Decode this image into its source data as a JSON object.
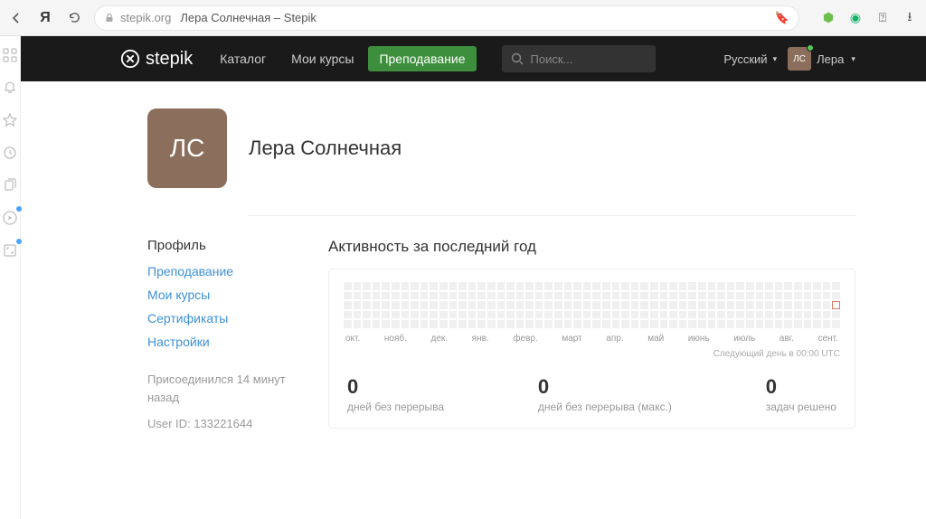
{
  "browser": {
    "domain": "stepik.org",
    "title": "Лера Солнечная – Stepik"
  },
  "topnav": {
    "brand": "stepik",
    "catalog": "Каталог",
    "my_courses": "Мои курсы",
    "teaching": "Преподавание",
    "search_placeholder": "Поиск...",
    "language": "Русский",
    "avatar_initials": "ЛС",
    "user_short": "Лера"
  },
  "profile": {
    "avatar_initials": "ЛС",
    "full_name": "Лера Солнечная"
  },
  "sidebar": {
    "head": "Профиль",
    "links": {
      "teaching": "Преподавание",
      "my_courses": "Мои курсы",
      "certificates": "Сертификаты",
      "settings": "Настройки"
    },
    "joined": "Присоединился 14 минут назад",
    "user_id_label": "User ID: 133221644"
  },
  "activity": {
    "heading": "Активность за последний год",
    "months": [
      "окт.",
      "нояб.",
      "дек.",
      "янв.",
      "февр.",
      "март",
      "апр.",
      "май",
      "июнь",
      "июль",
      "авг.",
      "сент."
    ],
    "footer_note": "Следующий день в 00:00 UTC",
    "stats": {
      "streak_val": "0",
      "streak_lbl": "дней без перерыва",
      "max_val": "0",
      "max_lbl": "дней без перерыва (макс.)",
      "solved_val": "0",
      "solved_lbl": "задач решено"
    }
  }
}
